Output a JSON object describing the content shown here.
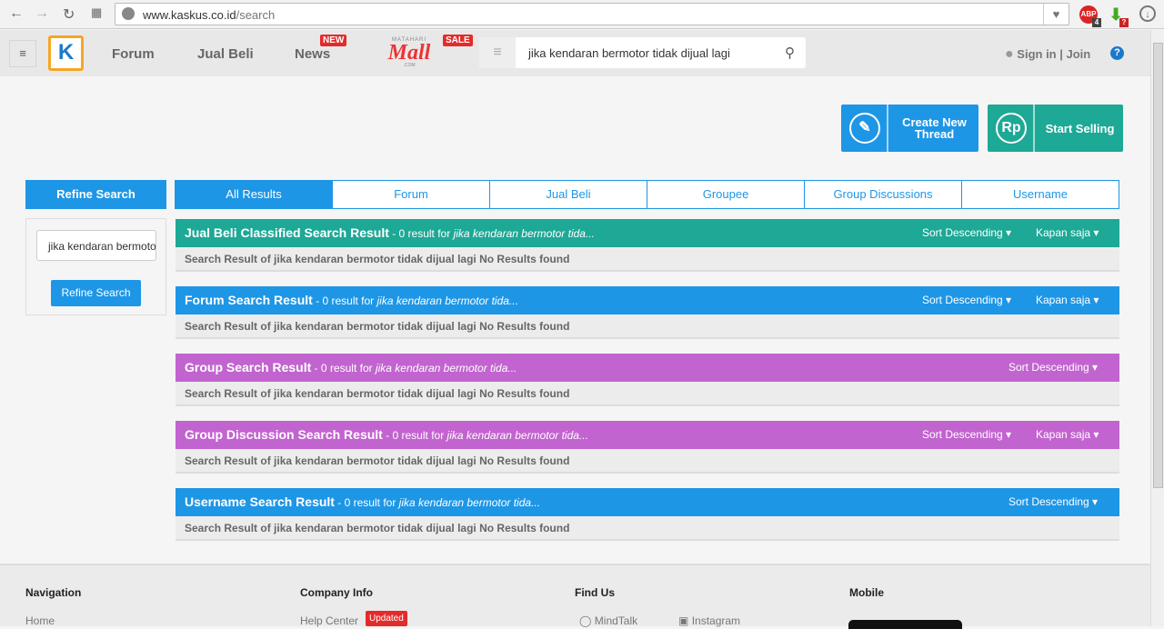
{
  "browser": {
    "url_host": "www.kaskus.co.id",
    "url_path": "/search",
    "abp_count": "4",
    "ext_badge": "?"
  },
  "header": {
    "nav": [
      "Forum",
      "Jual Beli",
      "News"
    ],
    "news_badge": "NEW",
    "mall_top": "MATAHARI",
    "mall_logo": "Mall",
    "mall_com": ".COM",
    "sale_badge": "SALE",
    "search_value": "jika kendaran bermotor tidak dijual lagi",
    "sign_in": "Sign in",
    "join": "Join",
    "help": "?"
  },
  "actions": {
    "create": "Create New Thread",
    "sell": "Start Selling",
    "rp": "Rp"
  },
  "sidebar": {
    "title": "Refine Search",
    "input_value": "jika kendaran bermotor tidak dijual lagi",
    "button": "Refine Search"
  },
  "tabs": [
    "All Results",
    "Forum",
    "Jual Beli",
    "Groupee",
    "Group Discussions",
    "Username"
  ],
  "colors": {
    "teal": "#1ea896",
    "blue": "#1e96e6",
    "purple": "#c264cf"
  },
  "sections": [
    {
      "title": "Jual Beli Classified Search Result",
      "count": " - 0 result for ",
      "query": "jika kendaran bermotor tida...",
      "sort": "Sort Descending",
      "time": "Kapan saja",
      "body": "Search Result of jika kendaran bermotor tidak dijual lagi No Results found",
      "color": "#1ea896"
    },
    {
      "title": "Forum Search Result",
      "count": " - 0 result for ",
      "query": "jika kendaran bermotor tida...",
      "sort": "Sort Descending",
      "time": "Kapan saja",
      "body": "Search Result of jika kendaran bermotor tidak dijual lagi No Results found",
      "color": "#1e96e6"
    },
    {
      "title": "Group Search Result",
      "count": " - 0 result for ",
      "query": "jika kendaran bermotor tida...",
      "sort": "Sort Descending",
      "body": "Search Result of jika kendaran bermotor tidak dijual lagi No Results found",
      "color": "#c264cf"
    },
    {
      "title": "Group Discussion Search Result",
      "count": " - 0 result for ",
      "query": "jika kendaran bermotor tida...",
      "sort": "Sort Descending",
      "time": "Kapan saja",
      "body": "Search Result of jika kendaran bermotor tidak dijual lagi No Results found",
      "color": "#c264cf"
    },
    {
      "title": "Username Search Result",
      "count": " - 0 result for ",
      "query": "jika kendaran bermotor tida...",
      "sort": "Sort Descending",
      "body": "Search Result of jika kendaran bermotor tidak dijual lagi No Results found",
      "color": "#1e96e6"
    }
  ],
  "footer": {
    "navigation": "Navigation",
    "home": "Home",
    "company": "Company Info",
    "help_center": "Help Center",
    "updated": "Updated",
    "find_us": "Find Us",
    "mindtalk": "MindTalk",
    "instagram": "Instagram",
    "mobile": "Mobile"
  }
}
